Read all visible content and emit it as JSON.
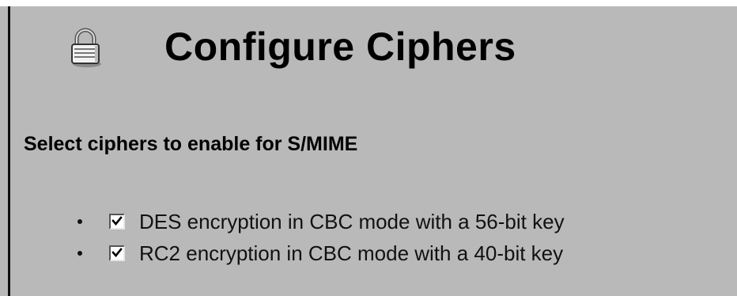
{
  "header": {
    "icon": "lock-icon",
    "title": "Configure Ciphers"
  },
  "section": {
    "heading": "Select ciphers to enable for S/MIME"
  },
  "ciphers": [
    {
      "label": "DES encryption in CBC mode with a 56-bit key",
      "checked": true
    },
    {
      "label": "RC2 encryption in CBC mode with a 40-bit key",
      "checked": true
    }
  ],
  "colors": {
    "background": "#b9b9b9",
    "text": "#000000",
    "checkbox_fill": "#ffffff"
  }
}
